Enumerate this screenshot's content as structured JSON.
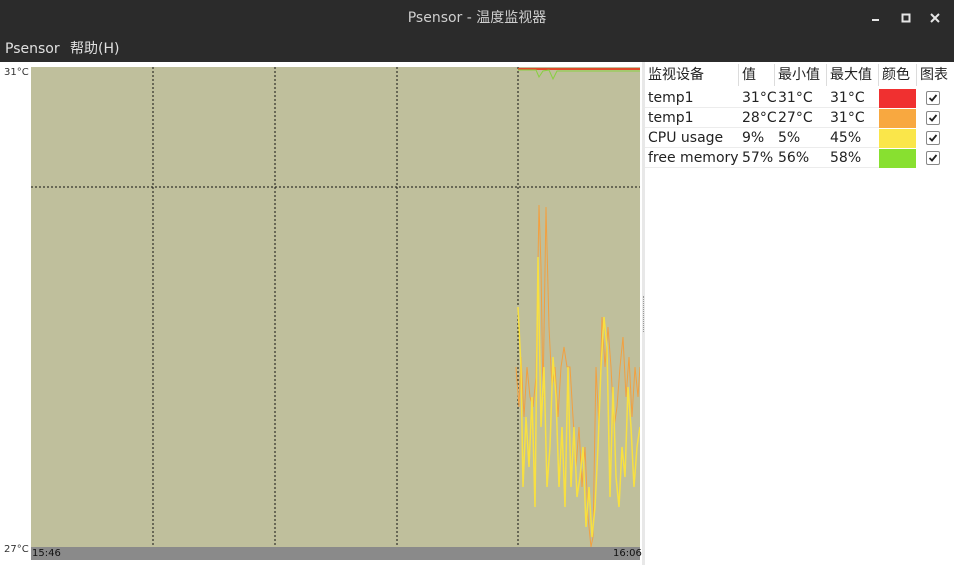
{
  "window": {
    "title": "Psensor - 温度监视器"
  },
  "menu": {
    "psensor": "Psensor",
    "help": "帮助(H)"
  },
  "graph": {
    "y_max_label": "31°C",
    "y_min_label": "27°C",
    "x_start_label": "15:46",
    "x_end_label": "16:06",
    "background": "#bfbf9c"
  },
  "table": {
    "headers": {
      "name": "监视设备",
      "value": "值",
      "min": "最小值",
      "max": "最大值",
      "color": "颜色",
      "graph": "图表"
    },
    "rows": [
      {
        "name": "temp1",
        "value": "31°C",
        "min": "31°C",
        "max": "31°C",
        "color": "#f03030",
        "graph": true
      },
      {
        "name": "temp1",
        "value": "28°C",
        "min": "27°C",
        "max": "31°C",
        "color": "#f8a840",
        "graph": true
      },
      {
        "name": "CPU usage",
        "value": "9%",
        "min": "5%",
        "max": "45%",
        "color": "#fae64a",
        "graph": true
      },
      {
        "name": "free memory",
        "value": "57%",
        "min": "56%",
        "max": "58%",
        "color": "#88e030",
        "graph": true
      }
    ]
  }
}
